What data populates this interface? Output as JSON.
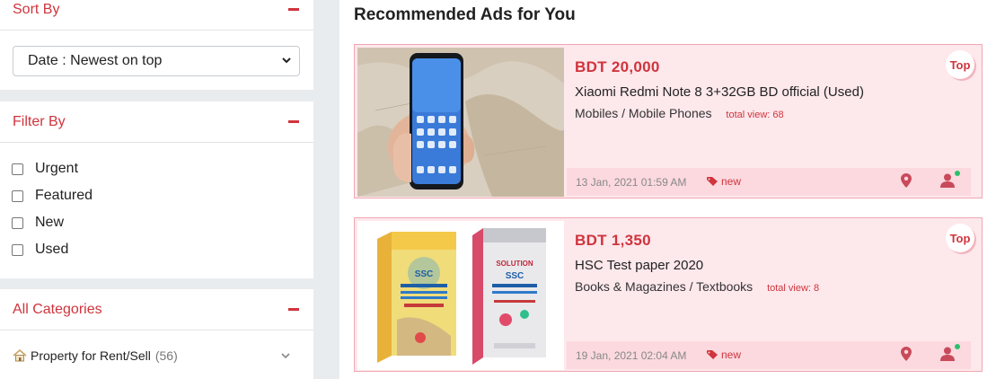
{
  "sidebar": {
    "sort": {
      "title": "Sort By",
      "selected": "Date : Newest on top"
    },
    "filter": {
      "title": "Filter By",
      "options": [
        "Urgent",
        "Featured",
        "New",
        "Used"
      ]
    },
    "categories": {
      "title": "All Categories",
      "items": [
        {
          "label": "Property for Rent/Sell",
          "count": "(56)"
        }
      ]
    }
  },
  "main": {
    "title": "Recommended Ads for You",
    "ads": [
      {
        "price": "BDT 20,000",
        "title": "Xiaomi Redmi Note 8 3+32GB BD official (Used)",
        "category": "Mobiles / Mobile Phones",
        "views": "total view: 68",
        "date": "13 Jan, 2021 01:59 AM",
        "tag": "new",
        "badge": "Top"
      },
      {
        "price": "BDT 1,350",
        "title": "HSC Test paper 2020",
        "category": "Books & Magazines / Textbooks",
        "views": "total view: 8",
        "date": "19 Jan, 2021 02:04 AM",
        "tag": "new",
        "badge": "Top"
      }
    ]
  },
  "colors": {
    "accent": "#d0343c",
    "card_bg": "#fde8ec",
    "online": "#2bbf6a"
  },
  "icons": [
    "minus-icon",
    "chevron-down-icon",
    "home-icon",
    "map-pin-icon",
    "user-icon",
    "tag-icon"
  ]
}
